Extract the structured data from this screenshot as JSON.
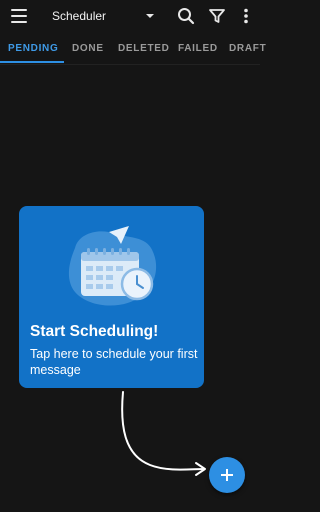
{
  "appbar": {
    "title": "Scheduler",
    "icons": [
      "menu-icon",
      "caret-down-icon",
      "search-icon",
      "filter-icon",
      "more-vert-icon"
    ]
  },
  "tabs": [
    {
      "label": "PENDING",
      "active": true
    },
    {
      "label": "DONE",
      "active": false
    },
    {
      "label": "DELETED",
      "active": false
    },
    {
      "label": "FAILED",
      "active": false
    },
    {
      "label": "DRAFT",
      "active": false
    }
  ],
  "onboarding": {
    "title": "Start Scheduling!",
    "body": "Tap here to schedule your first message",
    "illustration": "calendar-clock-paper-plane-illustration"
  },
  "fab": {
    "icon": "plus-icon"
  },
  "colors": {
    "background": "#151515",
    "accent": "#2d8fe3",
    "card": "#1272c7",
    "tab_inactive": "#9a9a9a"
  }
}
